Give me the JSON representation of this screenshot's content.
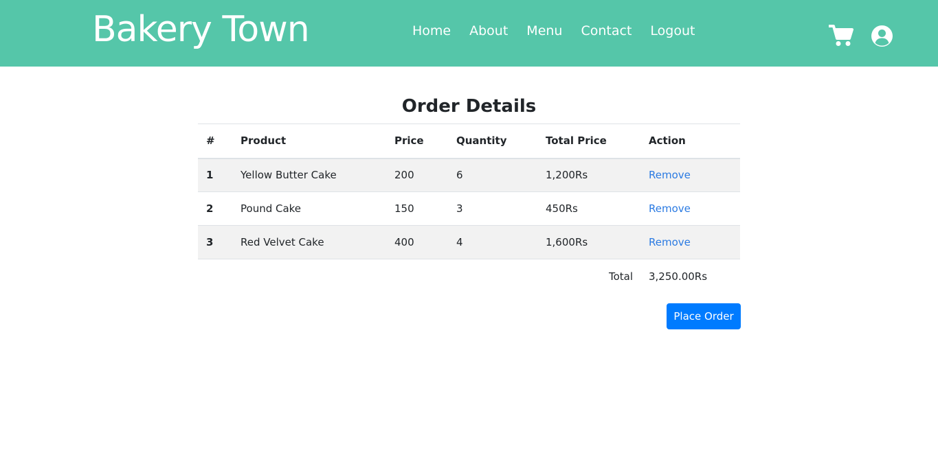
{
  "header": {
    "brand": "Bakery Town",
    "nav_items": [
      {
        "label": "Home"
      },
      {
        "label": "About"
      },
      {
        "label": "Menu"
      },
      {
        "label": "Contact"
      },
      {
        "label": "Logout"
      }
    ],
    "icons": [
      "cart-icon",
      "user-icon"
    ],
    "background_color": "#55c6a9"
  },
  "main": {
    "title": "Order Details",
    "table": {
      "columns": [
        "#",
        "Product",
        "Price",
        "Quantity",
        "Total Price",
        "Action"
      ],
      "rows": [
        {
          "num": "1",
          "product": "Yellow Butter Cake",
          "price": "200",
          "quantity": "6",
          "total": "1,200Rs",
          "action": "Remove"
        },
        {
          "num": "2",
          "product": "Pound Cake",
          "price": "150",
          "quantity": "3",
          "total": "450Rs",
          "action": "Remove"
        },
        {
          "num": "3",
          "product": "Red Velvet Cake",
          "price": "400",
          "quantity": "4",
          "total": "1,600Rs",
          "action": "Remove"
        }
      ]
    },
    "total_label": "Total",
    "total_value": "3,250.00Rs",
    "place_order_label": "Place Order",
    "link_color": "#2a7ae2",
    "button_color": "#007bff"
  }
}
